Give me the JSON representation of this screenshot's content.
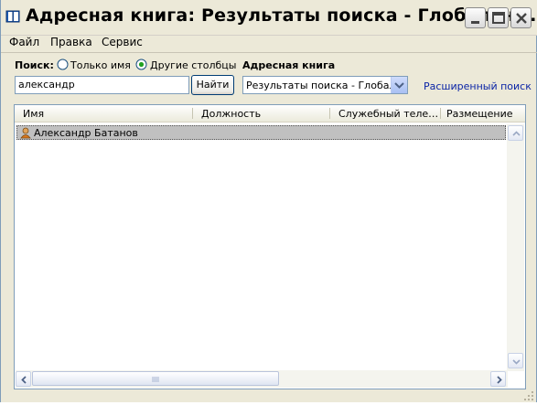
{
  "window": {
    "title": "Адресная книга: Результаты поиска - Глобальны…"
  },
  "menu": {
    "items": [
      "Файл",
      "Правка",
      "Сервис"
    ]
  },
  "search": {
    "label": "Поиск:",
    "option_name_only": "Только имя",
    "option_other_columns": "Другие столбцы",
    "selected_option": "Другие столбцы",
    "query_value": "александр",
    "find_button": "Найти"
  },
  "address_book": {
    "label": "Адресная книга",
    "selected": "Результаты поиска - Глобальн",
    "advanced_search_link": "Расширенный поиск"
  },
  "results": {
    "columns": [
      "Имя",
      "Должность",
      "Служебный теле…",
      "Размещение"
    ],
    "rows": [
      {
        "name": "Александр Батанов"
      }
    ]
  },
  "colors": {
    "window_bg": "#ece9d8",
    "link": "#0a24a6",
    "selected_row": "#c0c0c0",
    "border": "#7f9db9"
  },
  "icons": [
    "address-book-icon",
    "minimize-icon",
    "maximize-icon",
    "close-icon",
    "contact-icon",
    "dropdown-arrow-icon",
    "scroll-up-icon",
    "scroll-down-icon",
    "scroll-left-icon",
    "scroll-right-icon",
    "size-grip-icon"
  ]
}
